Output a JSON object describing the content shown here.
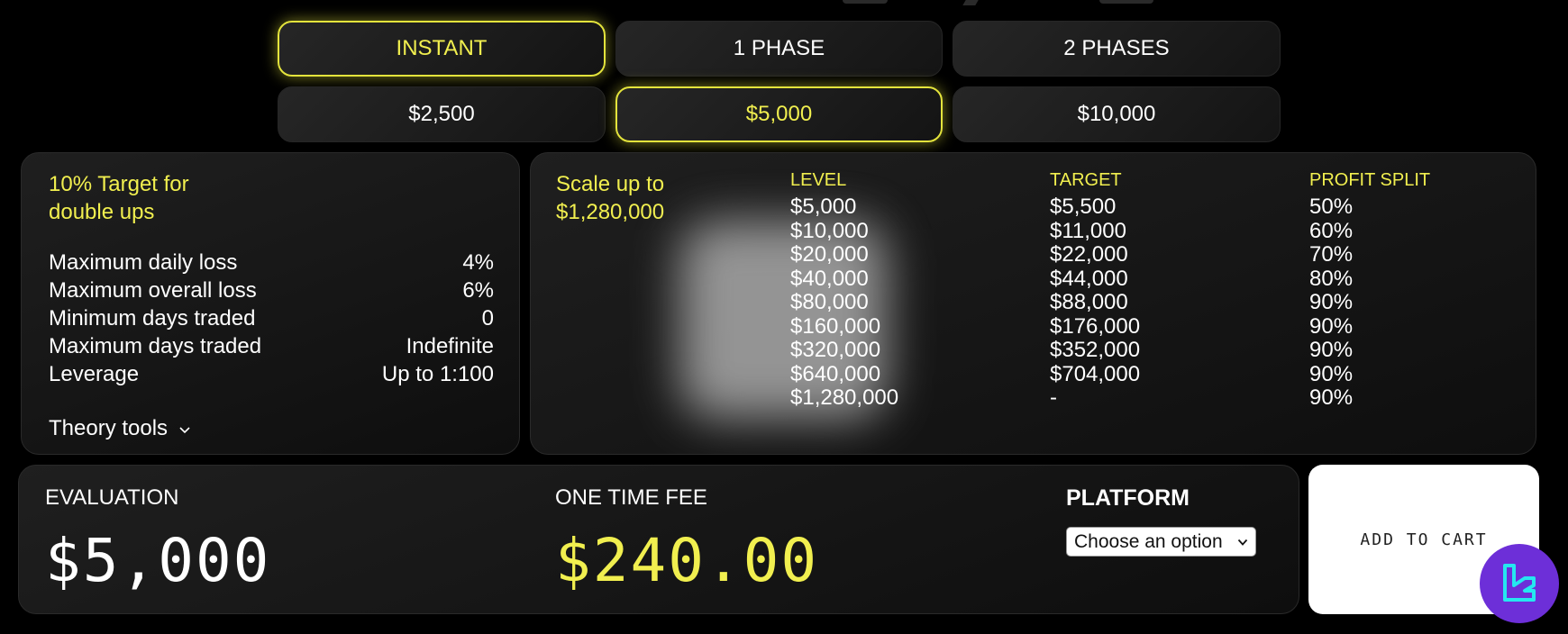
{
  "colors": {
    "accent": "#f1ef4f",
    "background": "#000000",
    "panel": "#1a1a1a",
    "logo_bg": "#6d2fd8",
    "logo_mark": "#25e7f0"
  },
  "challenge_types": [
    {
      "label": "INSTANT",
      "selected": true
    },
    {
      "label": "1 PHASE",
      "selected": false
    },
    {
      "label": "2 PHASES",
      "selected": false
    }
  ],
  "account_sizes": [
    {
      "label": "$2,500",
      "selected": false
    },
    {
      "label": "$5,000",
      "selected": true
    },
    {
      "label": "$10,000",
      "selected": false
    }
  ],
  "rules": {
    "title_line1": "10% Target for",
    "title_line2": "double ups",
    "items": [
      {
        "label": "Maximum daily loss",
        "value": "4%"
      },
      {
        "label": "Maximum overall loss",
        "value": "6%"
      },
      {
        "label": "Minimum days traded",
        "value": "0"
      },
      {
        "label": "Maximum days traded",
        "value": "Indefinite"
      },
      {
        "label": "Leverage",
        "value": "Up to 1:100"
      }
    ],
    "tools_label": "Theory tools",
    "tools_icon": "chevron-down-icon"
  },
  "scaling": {
    "title_line1": "Scale up to",
    "title_line2": "$1,280,000",
    "headers": [
      "LEVEL",
      "TARGET",
      "PROFIT SPLIT"
    ],
    "levels": [
      "$5,000",
      "$10,000",
      "$20,000",
      "$40,000",
      "$80,000",
      "$160,000",
      "$320,000",
      "$640,000",
      "$1,280,000"
    ],
    "targets": [
      "$5,500",
      "$11,000",
      "$22,000",
      "$44,000",
      "$88,000",
      "$176,000",
      "$352,000",
      "$704,000",
      "-"
    ],
    "splits": [
      "50%",
      "60%",
      "70%",
      "80%",
      "90%",
      "90%",
      "90%",
      "90%",
      "90%"
    ]
  },
  "checkout": {
    "evaluation_label": "EVALUATION",
    "evaluation_value": "$5,000",
    "fee_label": "ONE TIME FEE",
    "fee_value": "$240.00",
    "platform_label": "PLATFORM",
    "platform_select": "Choose an option",
    "cart_button": "ADD TO CART"
  }
}
